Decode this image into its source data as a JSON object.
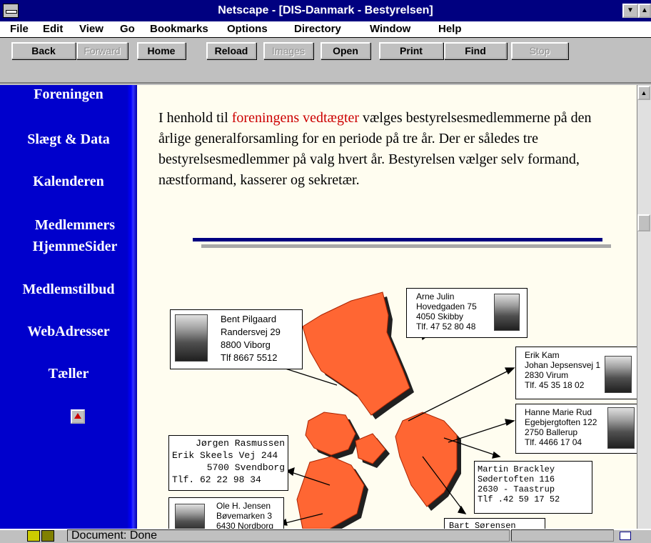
{
  "window": {
    "title": "Netscape - [DIS-Danmark - Bestyrelsen]"
  },
  "menu": {
    "file": "File",
    "edit": "Edit",
    "view": "View",
    "go": "Go",
    "bookmarks": "Bookmarks",
    "options": "Options",
    "directory": "Directory",
    "window": "Window",
    "help": "Help"
  },
  "toolbar": {
    "back": "Back",
    "forward": "Forward",
    "home": "Home",
    "reload": "Reload",
    "images": "Images",
    "open": "Open",
    "print": "Print",
    "find": "Find",
    "stop": "Stop"
  },
  "sidebar": {
    "items": [
      "Foreningen",
      "Slægt & Data",
      "Kalenderen",
      "Medlemmers HjemmeSider",
      "Medlemstilbud",
      "WebAdresser",
      "Tæller"
    ]
  },
  "content": {
    "para_before": "I henhold til ",
    "para_link": "foreningens vedtægter",
    "para_after": " vælges bestyrelsesmedlemmerne på den årlige generalforsamling for en periode på tre år. Der er således tre bestyrelsesmedlemmer på valg hvert år. Bestyrelsen vælger selv formand, næstformand, kasserer og sekretær."
  },
  "members": {
    "arne": {
      "name": "Arne Julin",
      "street": "Hovedgaden 75",
      "city": "4050 Skibby",
      "phone": "Tlf. 47 52 80 48"
    },
    "bent": {
      "name": "Bent Pilgaard",
      "street": "Randersvej 29",
      "city": "8800 Viborg",
      "phone": "Tlf 8667 5512"
    },
    "erik": {
      "name": "Erik Kam",
      "street": "Johan Jepsensvej 1",
      "city": "2830 Virum",
      "phone": "Tlf. 45 35 18 02"
    },
    "hanne": {
      "name": "Hanne Marie Rud",
      "street": "Egebjergtoften 122",
      "city": "2750 Ballerup",
      "phone": "Tlf. 4466 17 04"
    },
    "jorgen": {
      "name": "Jørgen Rasmussen",
      "street": "Erik Skeels Vej 244",
      "city": "5700 Svendborg",
      "phone": "Tlf.  62 22 98 34"
    },
    "martin": {
      "name": "Martin Brackley",
      "street": "Sødertoften 116",
      "city": "2630 - Taastrup",
      "phone": "Tlf .42 59 17 52"
    },
    "ole": {
      "name": "Ole H. Jensen",
      "street": "Bøvemarken 3",
      "city": "6430 Nordborg"
    },
    "bart": {
      "name": "Bart Sørensen"
    }
  },
  "status": {
    "text": "Document: Done"
  },
  "colors": {
    "titlebar": "#000080",
    "sidebar": "#0000cc",
    "content_bg": "#fffdf0",
    "link": "#cc0000",
    "map": "#ff6633"
  }
}
